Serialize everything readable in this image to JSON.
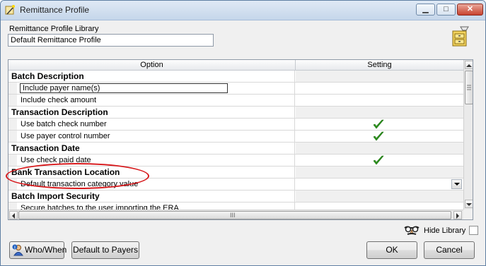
{
  "window": {
    "title": "Remittance Profile",
    "minimize_glyph": "▁",
    "maximize_glyph": "□",
    "close_glyph": "✕",
    "icon": "app-wand-icon"
  },
  "library": {
    "label": "Remittance Profile Library",
    "value": "Default Remittance Profile",
    "icon": "file-cabinet-icon"
  },
  "grid": {
    "columns": [
      "Option",
      "Setting"
    ],
    "rows": [
      {
        "type": "category",
        "option": "Batch Description"
      },
      {
        "type": "item",
        "option": "Include payer name(s)",
        "checked": false,
        "selected": true
      },
      {
        "type": "item",
        "option": "Include check amount",
        "checked": false
      },
      {
        "type": "category",
        "option": "Transaction Description"
      },
      {
        "type": "item",
        "option": "Use batch check number",
        "checked": true
      },
      {
        "type": "item",
        "option": "Use payer control number",
        "checked": true
      },
      {
        "type": "category",
        "option": "Transaction Date"
      },
      {
        "type": "item",
        "option": "Use check paid date",
        "checked": true
      },
      {
        "type": "category",
        "option": "Bank Transaction Location"
      },
      {
        "type": "item",
        "option": "Default transaction category value",
        "dropdown": true
      },
      {
        "type": "category",
        "option": "Batch Import Security"
      },
      {
        "type": "item",
        "option": "Secure batches to the user importing the ERA"
      }
    ],
    "hscroll_grip": "III",
    "annotation_color": "#d7191c",
    "check_color": "#2e9b1d"
  },
  "hide_library": {
    "label": "Hide Library",
    "checked": false,
    "icon": "disguise-glasses-icon"
  },
  "buttons": {
    "who_when": "Who/When",
    "default_to_payers": "Default to Payers",
    "ok": "OK",
    "cancel": "Cancel"
  }
}
